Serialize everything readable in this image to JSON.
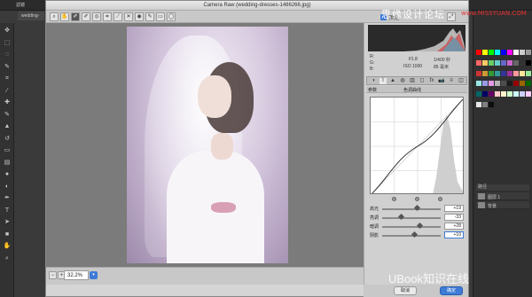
{
  "ps": {
    "menu": [
      "滤镜"
    ],
    "doc_tab": "wedding-",
    "tools": [
      "move-icon",
      "marquee-icon",
      "lasso-icon",
      "quick-select-icon",
      "crop-icon",
      "eyedropper-icon",
      "healing-icon",
      "brush-icon",
      "stamp-icon",
      "history-brush-icon",
      "eraser-icon",
      "gradient-icon",
      "blur-icon",
      "dodge-icon",
      "pen-icon",
      "type-icon",
      "path-select-icon",
      "shape-icon",
      "hand-icon",
      "zoom-icon"
    ],
    "swatch_colors": [
      "#ff0000",
      "#ffff00",
      "#00ff00",
      "#00ffff",
      "#0000ff",
      "#ff00ff",
      "#ffffff",
      "#cccccc",
      "#999999",
      "#ff6666",
      "#ffcc66",
      "#66cc66",
      "#66cccc",
      "#6666cc",
      "#cc66cc",
      "#666666",
      "#333333",
      "#000000",
      "#cc3333",
      "#cc9933",
      "#339933",
      "#339999",
      "#333399",
      "#993399",
      "#ff9999",
      "#ffe699",
      "#99e699",
      "#99e6e6",
      "#9999e6",
      "#e699e6",
      "#b3b3b3",
      "#4d4d4d",
      "#1a1a1a",
      "#990000",
      "#996600",
      "#006600",
      "#006666",
      "#000066",
      "#660066",
      "#ffcccc",
      "#fff2cc",
      "#ccffcc",
      "#ccffff",
      "#ccccff",
      "#ffccff",
      "#e6e6e6",
      "#808080",
      "#0d0d0d"
    ],
    "layers_hdr": "路径",
    "layers": [
      "图层 1",
      "背景"
    ]
  },
  "dialog": {
    "title": "Camera Raw (wedding-dresses-1486266.jpg)",
    "tools": [
      "zoom-icon",
      "hand-icon",
      "white-balance-icon",
      "color-sampler-icon",
      "targeted-adjust-icon",
      "crop-icon",
      "straighten-icon",
      "spot-removal-icon",
      "red-eye-icon",
      "adjustment-brush-icon",
      "graduated-filter-icon",
      "radial-filter-icon"
    ],
    "preview_label": "预览",
    "zoom": "32.2%",
    "info": {
      "r_label": "R:",
      "g_label": "G:",
      "b_label": "B:",
      "aperture": "f/1.8",
      "shutter": "1/400 秒",
      "iso": "ISO 1000",
      "focal": "85 毫米"
    },
    "tone_curve_tab": "参数",
    "tone_curve_title": "色调曲线",
    "sliders": [
      {
        "label": "高光",
        "value": "+19",
        "pos": 0.6
      },
      {
        "label": "亮调",
        "value": "-33",
        "pos": 0.33
      },
      {
        "label": "暗调",
        "value": "+28",
        "pos": 0.64
      },
      {
        "label": "阴影",
        "value": "+10",
        "pos": 0.55
      }
    ],
    "cancel_label": "取消",
    "ok_label": "确定"
  },
  "watermark": {
    "top": "思缘设计论坛",
    "url": "www.MISSYUAN.COM",
    "bottom": "UBook知识在线"
  }
}
